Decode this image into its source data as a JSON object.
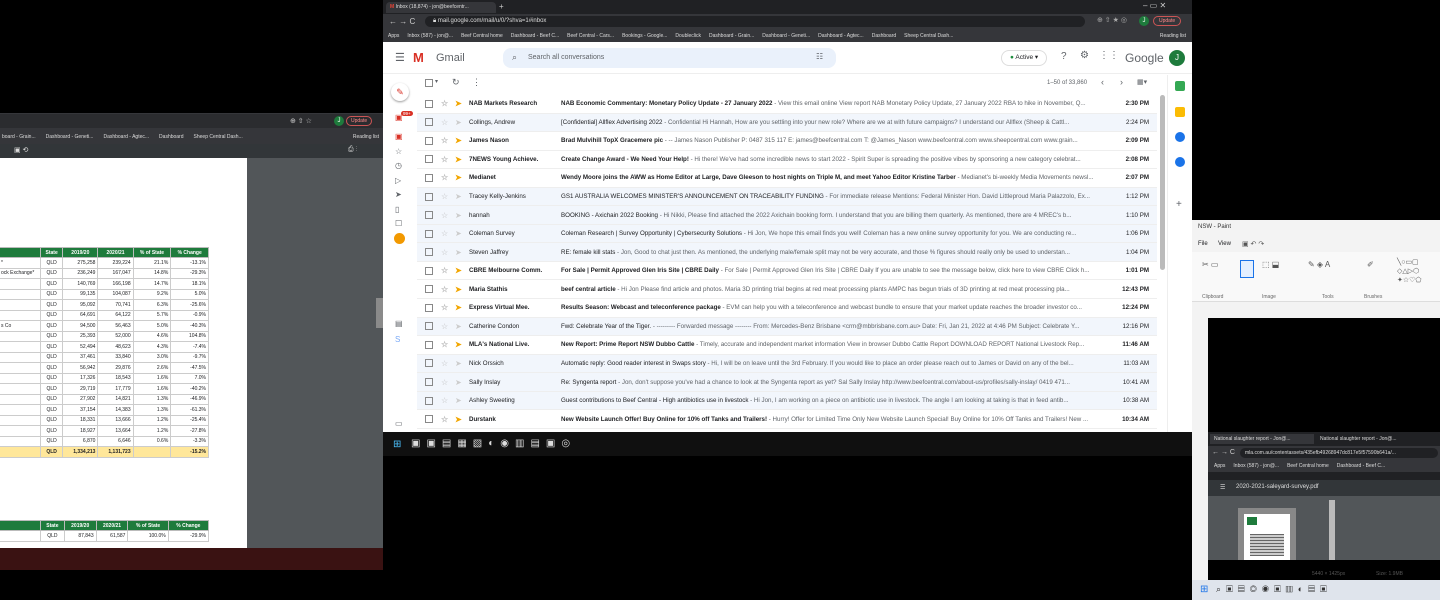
{
  "left_window": {
    "address": "← → C",
    "bookmarks": [
      "board - Grain...",
      "Dashboard - Geneti...",
      "Dashboard - Agtec...",
      "Dashboard",
      "Sheep Central Dash..."
    ],
    "reading_list": "Reading list",
    "update_label": "Update",
    "avatar": "J",
    "table1": {
      "headers": [
        "State",
        "2019/20",
        "2020/21",
        "% of State",
        "% Change"
      ],
      "labels": [
        "",
        "*",
        "ock Exchange*",
        "",
        "",
        "",
        "",
        "s Co",
        "",
        "",
        "",
        "",
        "",
        "",
        "",
        "",
        "",
        "",
        ""
      ],
      "rows": [
        [
          "QLD",
          "275,258",
          "239,224",
          "21.1%",
          "-13.1%"
        ],
        [
          "QLD",
          "236,249",
          "167,047",
          "14.8%",
          "-29.3%"
        ],
        [
          "QLD",
          "140,769",
          "166,198",
          "14.7%",
          "18.1%"
        ],
        [
          "QLD",
          "99,135",
          "104,087",
          "9.2%",
          "5.0%"
        ],
        [
          "QLD",
          "95,092",
          "70,741",
          "6.3%",
          "-25.6%"
        ],
        [
          "QLD",
          "64,691",
          "64,122",
          "5.7%",
          "-0.9%"
        ],
        [
          "QLD",
          "94,500",
          "56,463",
          "5.0%",
          "-40.3%"
        ],
        [
          "QLD",
          "25,393",
          "52,000",
          "4.6%",
          "104.8%"
        ],
        [
          "QLD",
          "52,494",
          "48,623",
          "4.3%",
          "-7.4%"
        ],
        [
          "QLD",
          "37,461",
          "33,840",
          "3.0%",
          "-9.7%"
        ],
        [
          "QLD",
          "56,942",
          "29,876",
          "2.6%",
          "-47.5%"
        ],
        [
          "QLD",
          "17,326",
          "18,543",
          "1.6%",
          "7.0%"
        ],
        [
          "QLD",
          "29,719",
          "17,779",
          "1.6%",
          "-40.2%"
        ],
        [
          "QLD",
          "27,902",
          "14,821",
          "1.3%",
          "-46.9%"
        ],
        [
          "QLD",
          "37,154",
          "14,383",
          "1.3%",
          "-61.3%"
        ],
        [
          "QLD",
          "18,331",
          "13,666",
          "1.2%",
          "-25.4%"
        ],
        [
          "QLD",
          "18,927",
          "13,664",
          "1.2%",
          "-27.8%"
        ],
        [
          "QLD",
          "6,870",
          "6,646",
          "0.6%",
          "-3.3%"
        ]
      ],
      "total": [
        "QLD",
        "1,334,213",
        "1,131,723",
        "",
        "-15.2%"
      ]
    },
    "table2": {
      "headers": [
        "State",
        "2019/20",
        "2020/21",
        "% of State",
        "% Change"
      ],
      "rows": [
        [
          "QLD",
          "87,843",
          "61,587",
          "100.0%",
          "-29.9%"
        ]
      ]
    }
  },
  "gmail": {
    "tab_title": "Inbox (18,874) - jon@beefcentr...",
    "url": "mail.google.com/mail/u/0/?shva=1#inbox",
    "update_label": "Update",
    "bookmarks": [
      "Apps",
      "Inbox (587) - jon@...",
      "Beef Central home",
      "Dashboard - Beef C...",
      "Beef Central - Cars...",
      "Bookings - Google...",
      "Doubleclick",
      "Dashboard - Grain...",
      "Dashboard - Geneti...",
      "Dashboard - Agtec...",
      "Dashboard",
      "Sheep Central Dash..."
    ],
    "reading_list": "Reading list",
    "app_name": "Gmail",
    "search_placeholder": "Search all conversations",
    "status": "Active",
    "brand": "Google",
    "avatar": "J",
    "range": "1–50 of 33,860",
    "compose_badge": "99+",
    "emails": [
      {
        "sender": "NAB Markets Research",
        "subject": "NAB Economic Commentary: Monetary Policy Update - 27 January 2022",
        "preview": " - View this email online View report NAB Monetary Policy Update, 27 January 2022 RBA to hike in November, Q...",
        "time": "2:30 PM",
        "unread": true
      },
      {
        "sender": "Collings, Andrew",
        "subject": "[Confidential] Allflex Advertising 2022",
        "preview": " - Confidential Hi Hannah, How are you settling into your new role? Where are we at with future campaigns? I understand our Allflex (Sheep & Cattl...",
        "time": "2:24 PM",
        "unread": false
      },
      {
        "sender": "James Nason",
        "subject": "Brad Mulvihill TopX Gracemere pic",
        "preview": " - -- James Nason Publisher P: 0487 315 117 E: james@beefcentral.com T: @James_Nason www.beefcentral.com www.sheepcentral.com www.grain...",
        "time": "2:09 PM",
        "unread": true
      },
      {
        "sender": "7NEWS Young Achieve.",
        "subject": "Create Change Award - We Need Your Help!",
        "preview": " - Hi there! We've had some incredible news to start 2022 - Spirit Super is spreading the positive vibes by sponsoring a new category celebrat...",
        "time": "2:08 PM",
        "unread": true
      },
      {
        "sender": "Medianet",
        "subject": "Wendy Moore joins the AWW as Home Editor at Large, Dave Gleeson to host nights on Triple M, and meet Yahoo Editor Kristine Tarber",
        "preview": " - Medianet's bi-weekly Media Movements newsl...",
        "time": "2:07 PM",
        "unread": true
      },
      {
        "sender": "Tracey Kelly-Jenkins",
        "subject": "GS1 AUSTRALIA WELCOMES MINISTER'S ANNOUNCEMENT ON TRACEABILITY FUNDING",
        "preview": " - For immediate release Mentions: Federal Minister Hon. David Littleproud Maria Palazzolo, Ex...",
        "time": "1:12 PM",
        "unread": false
      },
      {
        "sender": "hannah",
        "subject": "BOOKING - Axichain 2022 Booking",
        "preview": " - Hi Nikki, Please find attached the 2022 Axichain booking form. I understand that you are billing them quarterly. As mentioned, there are 4 MREC's b...",
        "time": "1:10 PM",
        "unread": false
      },
      {
        "sender": "Coleman Survey",
        "subject": "Coleman Research | Survey Opportunity | Cybersecurity Solutions",
        "preview": " - Hi Jon, We hope this email finds you well! Coleman has a new online survey opportunity for you. We are conducting re...",
        "time": "1:06 PM",
        "unread": false
      },
      {
        "sender": "Steven Jaffrey",
        "subject": "RE: female kill stats",
        "preview": " - Jon, Good to chat just then. As mentioned, the underlying male/female split may not be very accurate, and those % figures should really only be used to understan...",
        "time": "1:04 PM",
        "unread": false
      },
      {
        "sender": "CBRE Melbourne Comm.",
        "subject": "For Sale | Permit Approved Glen Iris Site | CBRE Daily",
        "preview": " - For Sale | Permit Approved Glen Iris Site | CBRE Daily If you are unable to see the message below, click here to view CBRE Click h...",
        "time": "1:01 PM",
        "unread": true
      },
      {
        "sender": "Maria Stathis",
        "subject": "beef central article",
        "preview": " - Hi Jon Please find article and photos. Maria 3D printing trial begins at red meat processing plants AMPC has begun trials of 3D printing at red meat processing pla...",
        "time": "12:43 PM",
        "unread": true
      },
      {
        "sender": "Express Virtual Mee.",
        "subject": "Results Season: Webcast and teleconference package",
        "preview": " - EVM can help you with a teleconference and webcast bundle to ensure that your market update reaches the broader investor co...",
        "time": "12:24 PM",
        "unread": true
      },
      {
        "sender": "Catherine Condon",
        "subject": "Fwd: Celebrate Year of the Tiger.",
        "preview": " - --------- Forwarded message -------- From: Mercedes-Benz Brisbane <crm@mbbrisbane.com.au> Date: Fri, Jan 21, 2022 at 4:46 PM Subject: Celebrate Y...",
        "time": "12:16 PM",
        "unread": false
      },
      {
        "sender": "MLA's National Live.",
        "subject": "New Report: Prime Report NSW Dubbo Cattle",
        "preview": " - Timely, accurate and independent market information View in browser Dubbo Cattle Report DOWNLOAD REPORT National Livestock Rep...",
        "time": "11:46 AM",
        "unread": true
      },
      {
        "sender": "Nick Orssich",
        "subject": "Automatic reply: Good reader interest in Swaps story",
        "preview": " - Hi, I will be on leave until the 3rd February. If you would like to place an order please reach out to James or David on any of the bel...",
        "time": "11:03 AM",
        "unread": false
      },
      {
        "sender": "Sally Inslay",
        "subject": "Re: Syngenta report",
        "preview": " - Jon, don't suppose you've had a chance to look at the Syngenta report as yet? Sal Sally Inslay http://www.beefcentral.com/about-us/profiles/sally-inslay/ 0419 471...",
        "time": "10:41 AM",
        "unread": false
      },
      {
        "sender": "Ashley Sweeting",
        "subject": "Guest contributions to Beef Central - High antibiotics use in livestock",
        "preview": " - Hi Jon, I am working on a piece on antibiotic use in livestock. The angle I am looking at taking is that in feed antib...",
        "time": "10:38 AM",
        "unread": false
      },
      {
        "sender": "Durstank",
        "subject": "New Website Launch Offer! Buy Online for 10% off Tanks and Trailers!",
        "preview": " - Hurry! Offer for Limited Time Only New Website Launch Special! Buy Online for 10% Off Tanks and Trailers! New ...",
        "time": "10:34 AM",
        "unread": true
      }
    ]
  },
  "paint": {
    "title": "NSW - Paint",
    "menu": [
      "File",
      "View"
    ],
    "groups": [
      "Clipboard",
      "Image",
      "Tools",
      "Brushes"
    ],
    "size_label": "Size: 1.9MB",
    "dims_label": "5440 × 1425px"
  },
  "chrome_small": {
    "tabs": [
      "National slaughter report - Jon@...",
      "National slaughter report - Jon@..."
    ],
    "url": "mla.com.au/contentassets/435efb49268947dc817e5f57590b641a/...",
    "bookmarks": [
      "Apps",
      "Inbox (587) - jon@...",
      "Beef Central home",
      "Dashboard - Beef C..."
    ],
    "file": "2020-2021-saleyard-survey.pdf"
  },
  "colors": {
    "gmail_red": "#d93025",
    "green_header": "#1e7b3c",
    "total_row": "#ffe79a"
  }
}
